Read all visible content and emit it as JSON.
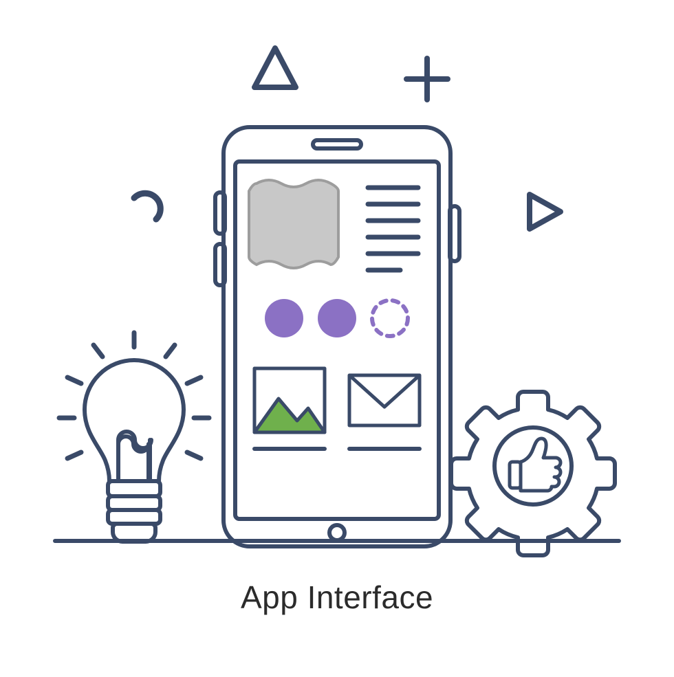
{
  "caption": "App Interface",
  "colors": {
    "outline": "#3a4a68",
    "cyan": "#2bc3e0",
    "screen": "#f1f1f1",
    "card": "#ffffff",
    "grey": "#c8c8c8",
    "purple": "#8b71c4",
    "green": "#a5cf60",
    "orange": "#f3a531",
    "tan": "#c79a63",
    "skyblue": "#38c4e0",
    "mountain": "#6fb04c"
  },
  "icons": {
    "phone": "phone-icon",
    "lightbulb": "lightbulb-icon",
    "gear": "gear-icon",
    "thumbs_up": "thumbs-up-icon",
    "image": "image-placeholder-icon",
    "envelope": "envelope-icon",
    "triangle": "triangle-deco-icon",
    "plus": "plus-deco-icon",
    "play": "play-deco-icon",
    "arc": "arc-deco-icon"
  }
}
